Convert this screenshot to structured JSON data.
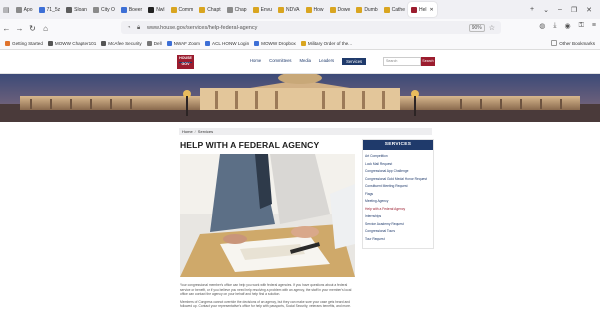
{
  "browser": {
    "tabs": [
      {
        "label": "Apo",
        "color": "#8a8a8a",
        "active": false
      },
      {
        "label": "71_5z",
        "color": "#3d6fd6",
        "active": false
      },
      {
        "label": "Sloan",
        "color": "#5c5c5c",
        "active": false
      },
      {
        "label": "City O",
        "color": "#8a8a8a",
        "active": false
      },
      {
        "label": "Boeer",
        "color": "#3d6fd6",
        "active": false
      },
      {
        "label": "Nwl",
        "color": "#222222",
        "active": false
      },
      {
        "label": "Comm",
        "color": "#d9a520",
        "active": false
      },
      {
        "label": "Chapt",
        "color": "#d9a520",
        "active": false
      },
      {
        "label": "Chap",
        "color": "#8a8a8a",
        "active": false
      },
      {
        "label": "Envu",
        "color": "#d9a520",
        "active": false
      },
      {
        "label": "NDVA",
        "color": "#d9a520",
        "active": false
      },
      {
        "label": "How",
        "color": "#d9a520",
        "active": false
      },
      {
        "label": "Dowe",
        "color": "#d9a520",
        "active": false
      },
      {
        "label": "Dumb",
        "color": "#d9a520",
        "active": false
      },
      {
        "label": "Cathe",
        "color": "#d9a520",
        "active": false
      },
      {
        "label": "Hel",
        "color": "#9b1c2e",
        "active": true
      }
    ],
    "url": "www.house.gov/services/help-federal-agency",
    "zoom": "90%",
    "bookmarks": [
      {
        "label": "Getting Started",
        "color": "#e0732c"
      },
      {
        "label": "MOWW Chapter101",
        "color": "#555555"
      },
      {
        "label": "McAfee Security",
        "color": "#555555"
      },
      {
        "label": "Dell",
        "color": "#777777"
      },
      {
        "label": "NWAF Zoom",
        "color": "#3d6fd6"
      },
      {
        "label": "ACL HONW Login",
        "color": "#3d6fd6"
      },
      {
        "label": "MOWW Dropbox",
        "color": "#3d6fd6"
      },
      {
        "label": "Military Order of the...",
        "color": "#d9a520"
      }
    ],
    "bookmarks_right": "Other Bookmarks"
  },
  "site": {
    "logo_text": [
      "HOUSE",
      "GOV"
    ],
    "nav": [
      {
        "label": "Home",
        "current": false
      },
      {
        "label": "Committees",
        "current": false
      },
      {
        "label": "Media",
        "current": false
      },
      {
        "label": "Leaders",
        "current": false
      },
      {
        "label": "Services",
        "current": true
      }
    ],
    "search_placeholder": "Search",
    "search_button": "Search"
  },
  "page": {
    "breadcrumb": [
      "Home",
      "Services"
    ],
    "title": "HELP WITH A FEDERAL AGENCY",
    "paragraphs": [
      "Your congressional member's office can help you work with federal agencies. If you have questions about a federal service or benefit, or if you believe you need help resolving a problem with an agency, the staff in your member's local office can contact the agency on your behalf and help find a solution.",
      "Members of Congress cannot override the decisions of an agency, but they can make sure your case gets heard and followed up. Contact your representative's office for help with passports, Social Security, veterans benefits, and more."
    ]
  },
  "services": {
    "heading": "SERVICES",
    "items": [
      {
        "label": "Art Competition",
        "active": false
      },
      {
        "label": "Lock Mail Request",
        "active": false
      },
      {
        "label": "Congressional App Challenge",
        "active": false
      },
      {
        "label": "Congressional Gold Medal Honor Request",
        "active": false
      },
      {
        "label": "Constituent Meeting Request",
        "active": false
      },
      {
        "label": "Flags",
        "active": false
      },
      {
        "label": "Meeting Agency",
        "active": false
      },
      {
        "label": "Help with a Federal Agency",
        "active": true
      },
      {
        "label": "Internships",
        "active": false
      },
      {
        "label": "Service Academy Request",
        "active": false
      },
      {
        "label": "Congressional Tours",
        "active": false
      },
      {
        "label": "Tour Request",
        "active": false
      }
    ]
  }
}
